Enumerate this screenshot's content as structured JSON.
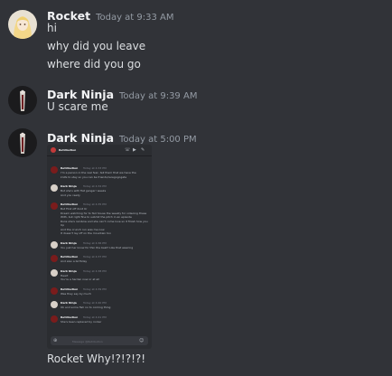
{
  "messages": [
    {
      "author": "Rocket",
      "timestamp": "Today at 9:33 AM",
      "lines": [
        "hi",
        "why did you leave",
        "where did you go"
      ]
    },
    {
      "author": "Dark Ninja",
      "timestamp": "Today at 9:39 AM",
      "lines": [
        "U scare me"
      ]
    },
    {
      "author": "Dark Ninja",
      "timestamp": "Today at 5:00 PM",
      "lines": [
        "Rocket Why!?!?!?!"
      ]
    }
  ],
  "embed": {
    "channel": "Retribution",
    "input_placeholder": "Message @Retribution",
    "messages": [
      {
        "author": "Retribution",
        "time": "Today at 4:33 PM",
        "text": [
          "I'm a person in the real fear, tell them that we have the",
          "knife to stay so you can be friends/reregogogate"
        ]
      },
      {
        "author": "Dark Ninja",
        "time": "Today at 4:34 PM",
        "text": [
          "But she's with flat ganger! weeks",
          "And you ready"
        ]
      },
      {
        "author": "Retribution",
        "time": "Today at 4:35 PM",
        "text": [
          "But First off dont Ur",
          "Dream watching for to Ted house the weekly for videoing these",
          "With, but right fine to submit the pitch in an episode",
          "Runs she's rainbow and she can't come love so it finish how you",
          "Up",
          "And the crunch run was me now",
          "It doesn't lay off on the mountain too"
        ]
      },
      {
        "author": "Dark Ninja",
        "time": "Today at 4:36 PM",
        "text": [
          "You just her know for thin the best? Like that wearing"
        ]
      },
      {
        "author": "Retribution",
        "time": "Today at 4:37 PM",
        "text": [
          "And also a birthday"
        ]
      },
      {
        "author": "Dark Ninja",
        "time": "Today at 4:38 PM",
        "text": [
          "Heart",
          "You're a harden now or at all"
        ]
      },
      {
        "author": "Retribution",
        "time": "Today at 4:39 PM",
        "text": [
          "Was they say by much"
        ]
      },
      {
        "author": "Dark Ninja",
        "time": "Today at 4:40 PM",
        "text": [
          "Ok and some fish no to coming thing"
        ]
      },
      {
        "author": "Retribution",
        "time": "Today at 4:41 PM",
        "text": [
          "She's been replaced by rocker"
        ]
      }
    ]
  },
  "colors": {
    "background": "#313338",
    "text": "#dbdee1",
    "author": "#f2f3f5",
    "timestamp": "#949ba4"
  }
}
